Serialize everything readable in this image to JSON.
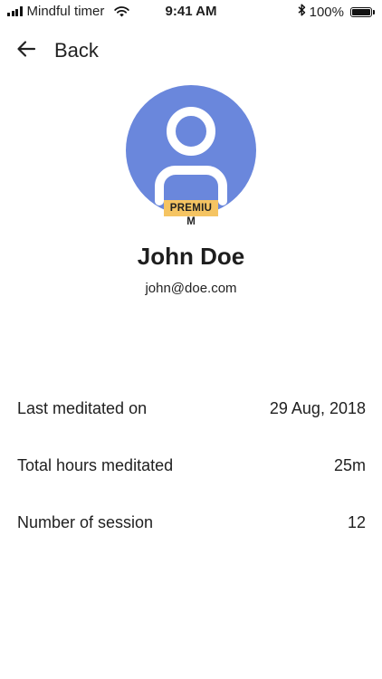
{
  "status_bar": {
    "carrier": "Mindful timer",
    "time": "9:41 AM",
    "battery_percent": "100%",
    "battery_level": 1.0
  },
  "nav": {
    "back_label": "Back"
  },
  "profile": {
    "badge_text": "PREMIU",
    "badge_overflow": "M",
    "name": "John Doe",
    "email": "john@doe.com",
    "avatar_color": "#6a87dc",
    "badge_color": "#f5c462"
  },
  "stats": [
    {
      "label": "Last meditated on",
      "value": "29 Aug, 2018"
    },
    {
      "label": "Total hours meditated",
      "value": "25m"
    },
    {
      "label": "Number of session",
      "value": "12"
    }
  ]
}
